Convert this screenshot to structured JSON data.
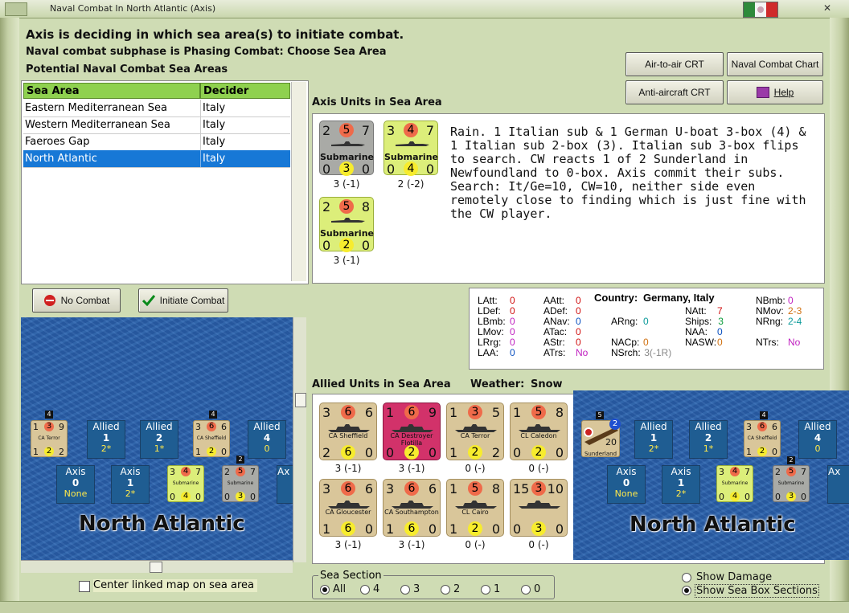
{
  "window": {
    "title": "Naval Combat In North Atlantic (Axis)"
  },
  "header": {
    "line1": "Axis is deciding in which sea area(s) to initiate combat.",
    "line2": "Naval combat subphase is Phasing Combat: Choose Sea Area",
    "line3": "Potential Naval Combat Sea Areas"
  },
  "buttons": {
    "air_to_air": "Air-to-air CRT",
    "naval_chart": "Naval Combat Chart",
    "anti_aircraft": "Anti-aircraft CRT",
    "help": "Help",
    "no_combat": "No Combat",
    "initiate_combat": "Initiate Combat"
  },
  "table": {
    "headers": [
      "Sea Area",
      "Decider"
    ],
    "rows": [
      {
        "area": "Eastern Mediterranean Sea",
        "decider": "Italy"
      },
      {
        "area": "Western Mediterranean Sea",
        "decider": "Italy"
      },
      {
        "area": "Faeroes Gap",
        "decider": "Italy"
      },
      {
        "area": "North Atlantic",
        "decider": "Italy",
        "selected": true
      }
    ]
  },
  "axis_units": {
    "title": "Axis Units in Sea Area",
    "units": [
      {
        "a": "2",
        "b": "5",
        "c": "7",
        "name": "Submarine",
        "d": "0",
        "e": "3",
        "f": "0",
        "label": "3 (-1)",
        "color": "grey"
      },
      {
        "a": "3",
        "b": "4",
        "c": "7",
        "name": "Submarine",
        "d": "0",
        "e": "4",
        "f": "0",
        "label": "2 (-2)",
        "color": "yellowgreen"
      },
      {
        "a": "2",
        "b": "5",
        "c": "8",
        "name": "Submarine",
        "d": "0",
        "e": "2",
        "f": "0",
        "label": "3 (-1)",
        "color": "yellowgreen"
      }
    ],
    "narrative": "Rain.  1 Italian sub & 1 German U-boat 3-box (4) & 1 Italian sub 2-box (3).   Italian sub 3-box flips to search.  CW reacts 1 of 2 Sunderland in Newfoundland to 0-box.  Axis commit their subs.  Search:  It/Ge=10, CW=10, neither side even remotely close to finding which is just fine with the CW player."
  },
  "stats": {
    "country_label": "Country:",
    "country": "Germany, Italy",
    "items": [
      {
        "k": "LAtt:",
        "v": "0",
        "color": "#d01010"
      },
      {
        "k": "LDef:",
        "v": "0",
        "color": "#d01010"
      },
      {
        "k": "LBmb:",
        "v": "0",
        "color": "#c020c0"
      },
      {
        "k": "LMov:",
        "v": "0",
        "color": "#c020c0"
      },
      {
        "k": "LRrg:",
        "v": "0",
        "color": "#c020c0"
      },
      {
        "k": "LAA:",
        "v": "0",
        "color": "#0a50c0"
      },
      {
        "k": "AAtt:",
        "v": "0",
        "color": "#d01010"
      },
      {
        "k": "ADef:",
        "v": "0",
        "color": "#d01010"
      },
      {
        "k": "ANav:",
        "v": "0",
        "color": "#0a50c0"
      },
      {
        "k": "ATac:",
        "v": "0",
        "color": "#d01010"
      },
      {
        "k": "AStr:",
        "v": "0",
        "color": "#d01010"
      },
      {
        "k": "ATrs:",
        "v": "No",
        "color": "#c020c0"
      },
      {
        "k": "ARng:",
        "v": "0",
        "color": "#0a9a9a"
      },
      {
        "k": "NACp:",
        "v": "0",
        "color": "#d07010"
      },
      {
        "k": "NSrch:",
        "v": "3(-1R)",
        "color": "#888888"
      },
      {
        "k": "NAtt:",
        "v": "7",
        "color": "#d01010"
      },
      {
        "k": "Ships:",
        "v": "3",
        "color": "#0a9a3a"
      },
      {
        "k": "NAA:",
        "v": "0",
        "color": "#0a50c0"
      },
      {
        "k": "NASW:",
        "v": "0",
        "color": "#d07010"
      },
      {
        "k": "NBmb:",
        "v": "0",
        "color": "#c020c0"
      },
      {
        "k": "NMov:",
        "v": "2-3",
        "color": "#d07010"
      },
      {
        "k": "NRng:",
        "v": "2-4",
        "color": "#0a9a9a"
      },
      {
        "k": "NTrs:",
        "v": "No",
        "color": "#c020c0"
      }
    ]
  },
  "allied_units": {
    "title": "Allied Units in Sea Area",
    "weather_label": "Weather:",
    "weather": "Snow",
    "units": [
      {
        "a": "3",
        "b": "6",
        "c": "6",
        "name": "CA Sheffield",
        "d": "2",
        "e": "6",
        "f": "0",
        "label": "3 (-1)",
        "color": "tan"
      },
      {
        "a": "1",
        "b": "6",
        "c": "9",
        "name": "CA Destroyer Flotilla",
        "d": "0",
        "e": "2",
        "f": "0",
        "label": "3 (-1)",
        "color": "red"
      },
      {
        "a": "1",
        "b": "3",
        "c": "5",
        "name": "CA Terror",
        "d": "1",
        "e": "2",
        "f": "2",
        "label": "0 (-)",
        "color": "tan"
      },
      {
        "a": "1",
        "b": "5",
        "c": "8",
        "name": "CL Caledon",
        "d": "0",
        "e": "2",
        "f": "0",
        "label": "0 (-)",
        "color": "tan"
      },
      {
        "a": "3",
        "b": "6",
        "c": "6",
        "name": "CA Gloucester",
        "d": "1",
        "e": "6",
        "f": "0",
        "label": "3 (-1)",
        "color": "tan"
      },
      {
        "a": "3",
        "b": "6",
        "c": "6",
        "name": "CA Southampton",
        "d": "1",
        "e": "6",
        "f": "0",
        "label": "3 (-1)",
        "color": "tan"
      },
      {
        "a": "1",
        "b": "5",
        "c": "8",
        "name": "CL Cairo",
        "d": "1",
        "e": "2",
        "f": "0",
        "label": "0 (-)",
        "color": "tan"
      },
      {
        "a": "15",
        "b": "3",
        "c": "10",
        "name": "",
        "d": "0",
        "e": "3",
        "f": "0",
        "label": "0 (-)",
        "color": "tan"
      }
    ]
  },
  "map": {
    "sea_name": "North Atlantic",
    "allied_boxes": [
      {
        "side": "Allied",
        "n": "1",
        "s": "2*"
      },
      {
        "side": "Allied",
        "n": "2",
        "s": "1*"
      },
      {
        "side": "Allied",
        "n": "4",
        "s": "0"
      }
    ],
    "axis_boxes": [
      {
        "side": "Axis",
        "n": "0",
        "s": "None"
      },
      {
        "side": "Axis",
        "n": "1",
        "s": "2*"
      }
    ],
    "axis_box_partial": "Ax",
    "center_checkbox": "Center linked map on sea area",
    "stack_counts": {
      "terror": "4",
      "sheffield": "4",
      "sub": "2",
      "sunderland": "5"
    },
    "sunderland": {
      "a": "2",
      "b": "20",
      "name": "Sunderland",
      "badge": "2"
    }
  },
  "sea_section": {
    "label": "Sea Section",
    "options": [
      "All",
      "4",
      "3",
      "2",
      "1",
      "0"
    ],
    "selected": "All"
  },
  "display_options": {
    "show_damage": "Show Damage",
    "show_sections": "Show Sea Box Sections",
    "selected": "show_sections"
  }
}
